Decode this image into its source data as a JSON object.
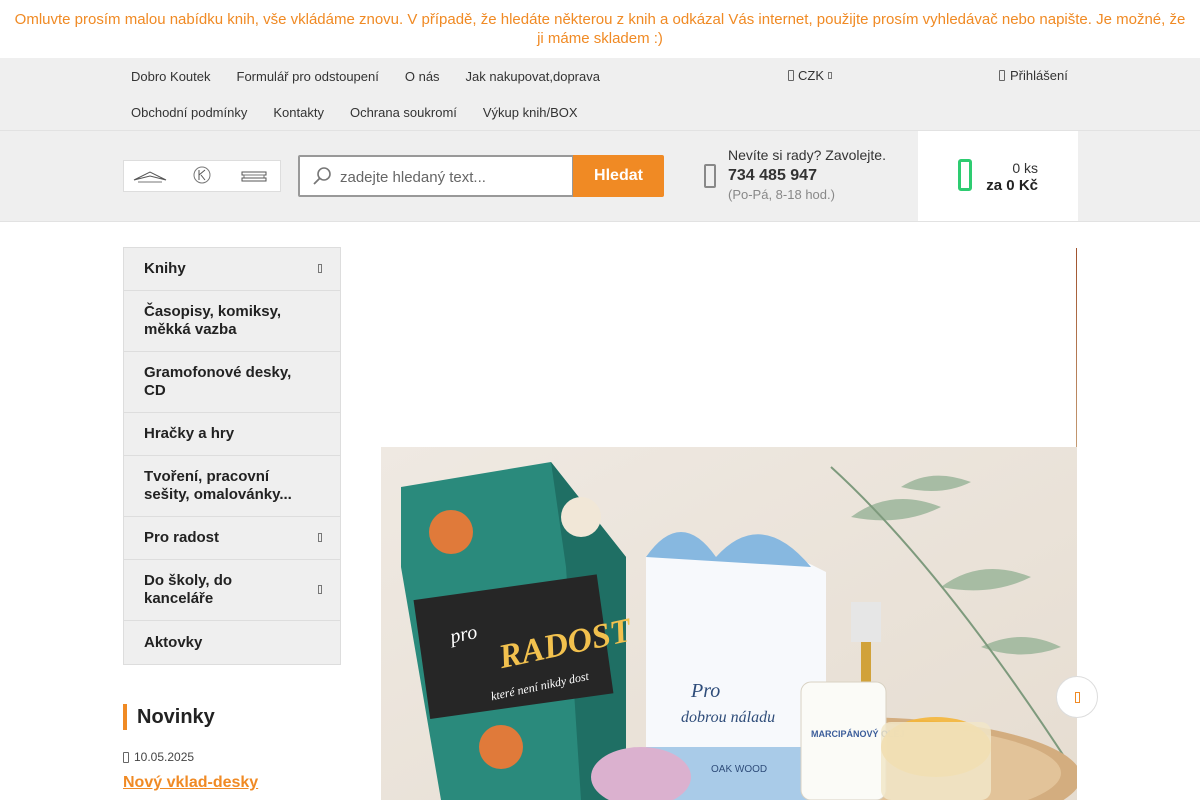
{
  "notice": "Omluvte prosím malou nabídku knih, vše vkládáme znovu. V případě, že hledáte některou z knih a odkázal Vás internet, použijte prosím vyhledávač nebo napište. Je možné, že ji máme skladem :)",
  "topnav": {
    "row1": [
      "Dobro Koutek",
      "Formulář pro odstoupení",
      "O nás",
      "Jak nakupovat,doprava"
    ],
    "row2": [
      "Obchodní podmínky",
      "Kontakty",
      "Ochrana soukromí",
      "Výkup knih/BOX"
    ],
    "currency": "CZK",
    "login": "Přihlášení"
  },
  "header": {
    "logo_alt": "Dobro Koutek",
    "search_placeholder": "zadejte hledaný text...",
    "search_button": "Hledat",
    "help_question": "Nevíte si rady? Zavolejte.",
    "phone": "734 485 947",
    "hours": "(Po-Pá, 8-18 hod.)",
    "cart_count": "0 ks",
    "cart_total": "za 0 Kč"
  },
  "categories": [
    {
      "label": "Knihy",
      "has_sub": true
    },
    {
      "label": "Časopisy, komiksy, měkká vazba",
      "has_sub": false
    },
    {
      "label": "Gramofonové desky, CD",
      "has_sub": false
    },
    {
      "label": "Hračky a hry",
      "has_sub": false
    },
    {
      "label": "Tvoření, pracovní sešity, omalovánky...",
      "has_sub": false
    },
    {
      "label": "Pro radost",
      "has_sub": true
    },
    {
      "label": "Do školy, do kanceláře",
      "has_sub": true
    },
    {
      "label": "Aktovky",
      "has_sub": false
    }
  ],
  "news": {
    "heading": "Novinky",
    "date": "10.05.2025",
    "link": "Nový vklad-desky"
  },
  "banner": {
    "box_text_1": "pro",
    "box_text_2": "RADOST",
    "box_text_3": "které není nikdy dost",
    "package_text_1": "Pro",
    "package_text_2": "dobrou náladu",
    "package_text_3": "OAK WOOD",
    "bottle_text": "MARCIPÁNOVÝ OLEJ"
  },
  "colors": {
    "accent": "#f08a24",
    "cart_icon": "#2ecc71",
    "nav_bg": "#efefef"
  }
}
